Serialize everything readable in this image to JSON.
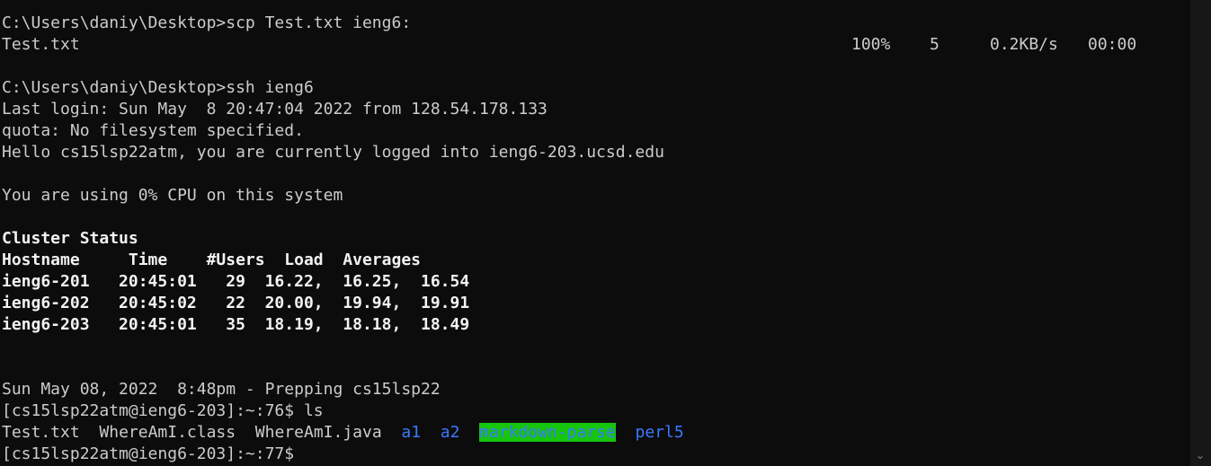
{
  "terminal": {
    "scp_command": "C:\\Users\\daniy\\Desktop>scp Test.txt ieng6:",
    "transfer": {
      "file": "Test.txt",
      "percent": "100%",
      "size": "5",
      "rate": "0.2KB/s",
      "time": "00:00"
    },
    "ssh_command": "C:\\Users\\daniy\\Desktop>ssh ieng6",
    "last_login": "Last login: Sun May  8 20:47:04 2022 from 128.54.178.133",
    "quota": "quota: No filesystem specified.",
    "hello": "Hello cs15lsp22atm, you are currently logged into ieng6-203.ucsd.edu",
    "cpu": "You are using 0% CPU on this system",
    "cluster_title": "Cluster Status",
    "cluster_header": "Hostname     Time    #Users  Load  Averages",
    "cluster_rows": [
      "ieng6-201   20:45:01   29  16.22,  16.25,  16.54",
      "ieng6-202   20:45:02   22  20.00,  19.94,  19.91",
      "ieng6-203   20:45:01   35  18.19,  18.18,  18.49"
    ],
    "prep": "Sun May 08, 2022  8:48pm - Prepping cs15lsp22",
    "prompt_ls": "[cs15lsp22atm@ieng6-203]:~:76$ ls",
    "ls_files": [
      "Test.txt",
      "WhereAmI.class",
      "WhereAmI.java"
    ],
    "ls_dirs": [
      "a1",
      "a2"
    ],
    "ls_highlight_dir": "markdown-parse",
    "ls_last_dir": "perl5",
    "prompt_final": "[cs15lsp22atm@ieng6-203]:~:77$"
  },
  "scrollbar": {
    "down_icon": "chevron-down-icon"
  },
  "colors": {
    "background": "#0c0c0c",
    "text": "#cccccc",
    "directory": "#3b78ff",
    "highlight": "#16c60c"
  }
}
